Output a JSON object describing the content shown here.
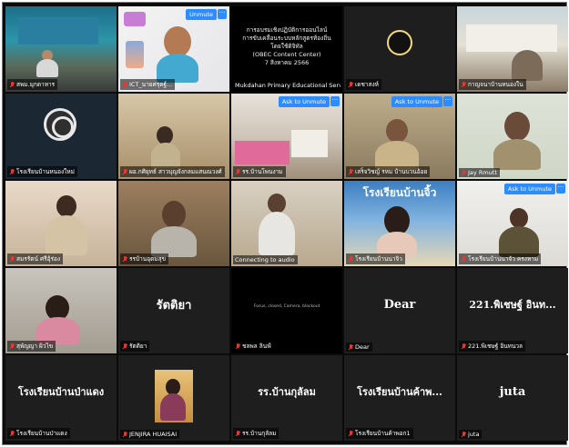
{
  "meeting": {
    "tiles": [
      {
        "name": "สพม.มุกดาหาร",
        "muted": true
      },
      {
        "name": "ICT_นายศรุตฐ์...",
        "muted": true,
        "badge": "Unmute"
      },
      {
        "name": "Mukdahan Primary Educational Servi...",
        "muted": false,
        "content_lines": [
          "การอบรมเชิงปฏิบัติการออนไลน์",
          "การขับเคลื่อนระบบหลักสูตรท้องถิ่นโดยใช้ดิจิทัล",
          "(OBEC Content Center)",
          "7 สิงหาคม 2566"
        ]
      },
      {
        "name": "เดชาสงห์",
        "muted": true
      },
      {
        "name": "กาญจนาบ้านหนองใน",
        "muted": true
      },
      {
        "name": "โรงเรียนบ้านหนองใหม่",
        "muted": true
      },
      {
        "name": "ผอ.กศิยุทธ์ สาวบุญจังกลมแสนณวงศ์",
        "muted": true
      },
      {
        "name": "รร.บ้านโพนงาม",
        "muted": true,
        "badge": "Ask to Unmute"
      },
      {
        "name": "เสร็จวิชญ์ รหม บ้านบวนอ้อย",
        "muted": true,
        "badge": "Ask to Unmute"
      },
      {
        "name": "Jay Rmutt",
        "muted": true
      },
      {
        "name": "สมรรัตน์ ศรีอุ้ร่อง",
        "muted": true
      },
      {
        "name": "รรบ้านอุดมสุข",
        "muted": true
      },
      {
        "name": "Connecting to audio",
        "muted": false
      },
      {
        "name": "โรงเรียนบ้านนาจิว",
        "muted": true,
        "banner": "โรงเรียนบ้านจิ้ว"
      },
      {
        "name": "โรงเรียนบ้านนาจัว ครงหาม",
        "muted": true,
        "badge": "Ask to Unmute"
      },
      {
        "name": "สุพัญญา ผิวไข",
        "muted": true
      },
      {
        "name": "รัตติยา",
        "muted": true,
        "display": "รัตติยา"
      },
      {
        "name": "ชลพล ลินฟ์",
        "muted": true,
        "display": "Focus, closed, Camera, blackout"
      },
      {
        "name": "Dear",
        "muted": true,
        "display": "Dear"
      },
      {
        "name": "221.พิเชษฐ์ อินทนวล",
        "muted": true,
        "display": "221.พิเชษฐ์ อินท..."
      },
      {
        "name": "โรงเรียนบ้านป่าแดง",
        "muted": true,
        "display": "โรงเรียนบ้านป่าแดง"
      },
      {
        "name": "JENJIRA HUAISAI",
        "muted": true
      },
      {
        "name": "รร.บ้านกุลัลม",
        "muted": true,
        "display": "รร.บ้านกุลัลม"
      },
      {
        "name": "โรงเรียนบ้านค้าพอก1",
        "muted": true,
        "display": "โรงเรียนบ้านค้าพ..."
      },
      {
        "name": "juta",
        "muted": true,
        "display": "juta"
      }
    ],
    "colors": {
      "accent": "#2d8cff",
      "active_border": "#e8e25a",
      "muted": "#e53935"
    }
  }
}
